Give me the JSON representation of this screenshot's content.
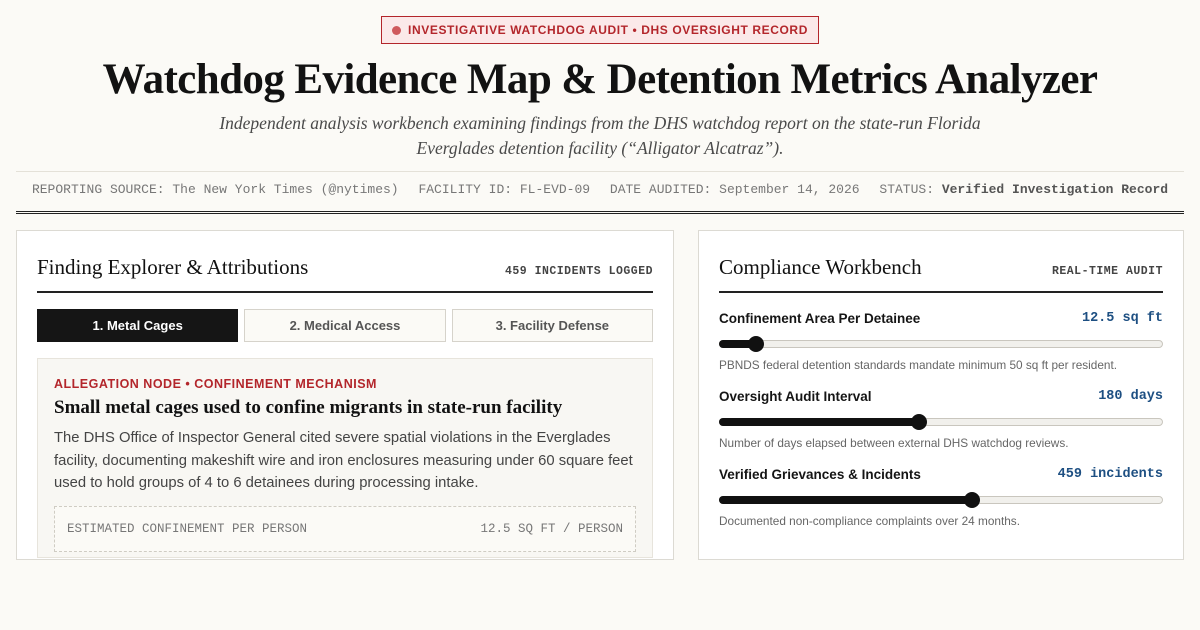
{
  "header": {
    "badge": "INVESTIGATIVE WATCHDOG AUDIT • DHS OVERSIGHT RECORD",
    "title": "Watchdog Evidence Map & Detention Metrics Analyzer",
    "subtitle": "Independent analysis workbench examining findings from the DHS watchdog report on the state-run Florida Everglades detention facility (“Alligator Alcatraz”)."
  },
  "meta": {
    "source_label": "REPORTING SOURCE:",
    "source_value": "The New York Times (@nytimes)",
    "facility_label": "FACILITY ID:",
    "facility_value": "FL-EVD-09",
    "date_label": "DATE AUDITED:",
    "date_value": "September 14, 2026",
    "status_label": "STATUS:",
    "status_value": "Verified Investigation Record"
  },
  "left_panel": {
    "title": "Finding Explorer & Attributions",
    "tag": "459 INCIDENTS LOGGED",
    "tabs": [
      {
        "label": "1. Metal Cages"
      },
      {
        "label": "2. Medical Access"
      },
      {
        "label": "3. Facility Defense"
      }
    ],
    "card": {
      "label": "ALLEGATION NODE • CONFINEMENT MECHANISM",
      "title": "Small metal cages used to confine migrants in state-run facility",
      "body": "The DHS Office of Inspector General cited severe spatial violations in the Everglades facility, documenting makeshift wire and iron enclosures measuring under 60 square feet used to hold groups of 4 to 6 detainees during processing intake.",
      "metric_label": "ESTIMATED CONFINEMENT PER PERSON",
      "metric_value": "12.5 SQ FT / PERSON"
    }
  },
  "right_panel": {
    "title": "Compliance Workbench",
    "tag": "REAL-TIME AUDIT",
    "controls": [
      {
        "label": "Confinement Area Per Detainee",
        "value": "12.5 sq ft",
        "level": 0.083,
        "help": "PBNDS federal detention standards mandate minimum 50 sq ft per resident."
      },
      {
        "label": "Oversight Audit Interval",
        "value": "180 days",
        "level": 0.45,
        "help": "Number of days elapsed between external DHS watchdog reviews."
      },
      {
        "label": "Verified Grievances & Incidents",
        "value": "459 incidents",
        "level": 0.57,
        "help": "Documented non-compliance complaints over 24 months."
      }
    ]
  }
}
